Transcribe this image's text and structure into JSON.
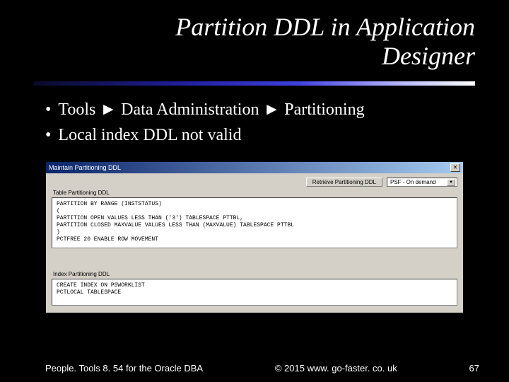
{
  "title": "Partition DDL in Application Designer",
  "bullets": {
    "b1_part1": "Tools ",
    "arrow": "►",
    "b1_part2": " Data Administration ",
    "b1_part3": " Partitioning",
    "b2": "Local index DDL not valid"
  },
  "window": {
    "title": "Maintain Partitioning DDL",
    "close": "✕",
    "retrieve_btn": "Retrieve Partitioning DDL",
    "dropdown_value": "PSF - On demand",
    "section1_label": "Table Partitioning DDL",
    "section1_text": "PARTITION BY RANGE (INSTSTATUS)\n(\nPARTITION OPEN VALUES LESS THAN ('3') TABLESPACE PTTBL,\nPARTITION CLOSED MAXVALUE VALUES LESS THAN (MAXVALUE) TABLESPACE PTTBL\n)\nPCTFREE 20 ENABLE ROW MOVEMENT",
    "section2_label": "Index Partitioning DDL",
    "section2_text": "CREATE INDEX ON PSWORKLIST\nPCTLOCAL TABLESPACE"
  },
  "footer": {
    "left": "People. Tools 8. 54 for the Oracle DBA",
    "center": "© 2015 www. go-faster. co. uk",
    "right": "67"
  }
}
